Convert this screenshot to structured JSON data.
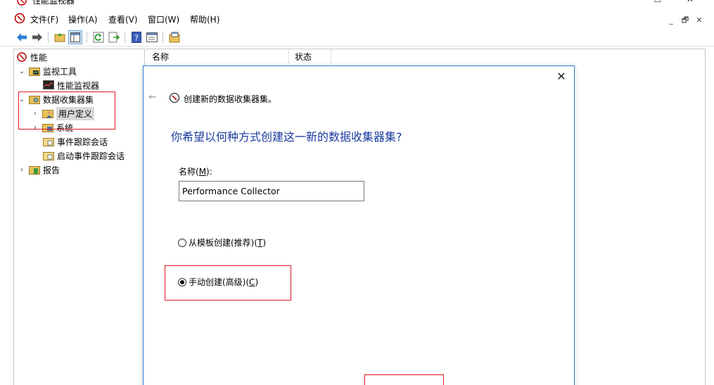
{
  "window": {
    "title": "性能监视器",
    "controls": [
      "—",
      "☐",
      "✕"
    ]
  },
  "menu": {
    "items": [
      "文件(F)",
      "操作(A)",
      "查看(V)",
      "窗口(W)",
      "帮助(H)"
    ],
    "mdi_controls": [
      "_",
      "🗗",
      "✕"
    ]
  },
  "toolbar": {
    "icons": [
      "back-arrow-icon",
      "forward-arrow-icon",
      "up-folder-icon",
      "show-hide-tree-icon",
      "refresh-icon",
      "export-list-icon",
      "help-icon",
      "properties-icon",
      "new-window-icon"
    ]
  },
  "tree": {
    "root": "性能",
    "monitoring_tools": "监视工具",
    "perf_monitor": "性能监视器",
    "data_collector_sets": "数据收集器集",
    "user_defined": "用户定义",
    "system": "系统",
    "event_trace": "事件跟踪会话",
    "startup_event_trace": "启动事件跟踪会话",
    "reports": "报告"
  },
  "list": {
    "columns": [
      "名称",
      "状态"
    ]
  },
  "dialog": {
    "header": "创建新的数据收集器集。",
    "question": "你希望以何种方式创建这一新的数据收集器集?",
    "name_label_prefix": "名称(",
    "name_label_key": "M",
    "name_label_suffix": "):",
    "name_value": "Performance Collector",
    "option_template_prefix": "从模板创建(推荐)(",
    "option_template_key": "T",
    "option_template_suffix": ")",
    "option_template_selected": false,
    "option_manual_prefix": "手动创建(高级)(",
    "option_manual_key": "C",
    "option_manual_suffix": ")",
    "option_manual_selected": true
  },
  "colors": {
    "annotation_red": "#e0191f",
    "dialog_border": "#2a7fd4",
    "question_text": "#1a3a9e"
  }
}
